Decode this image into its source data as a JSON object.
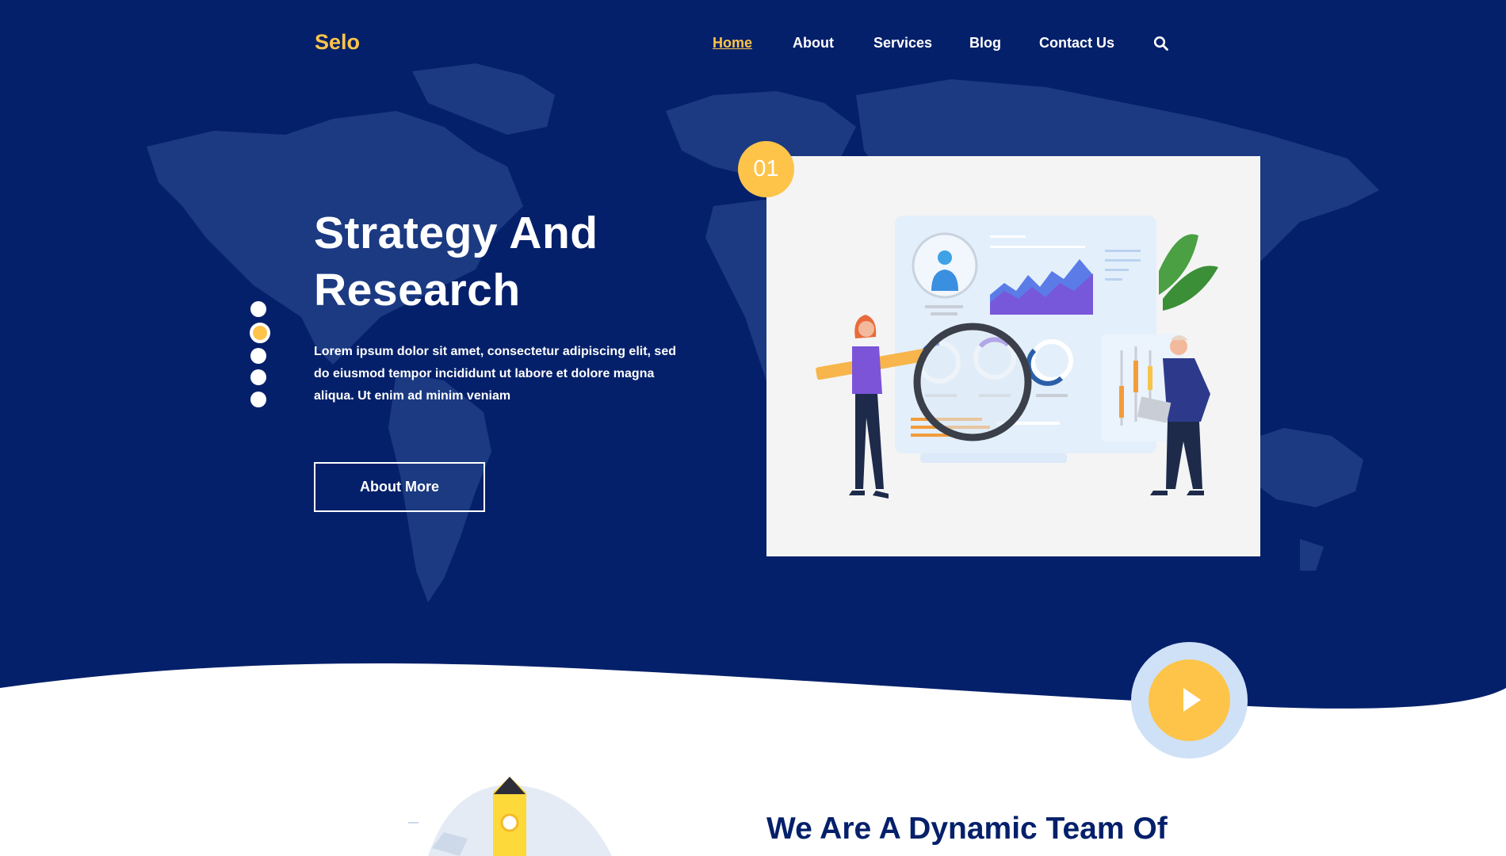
{
  "brand": {
    "logo": "Selo"
  },
  "nav": {
    "items": [
      {
        "label": "Home",
        "active": true
      },
      {
        "label": "About"
      },
      {
        "label": "Services"
      },
      {
        "label": "Blog"
      },
      {
        "label": "Contact Us"
      }
    ],
    "search_icon": "search-icon"
  },
  "hero": {
    "title_line1": "Strategy And",
    "title_line2": "Research",
    "description": "Lorem ipsum dolor sit amet, consectetur adipiscing elit, sed do eiusmod tempor incididunt ut labore et dolore magna aliqua. Ut enim ad minim veniam",
    "button_label": "About More",
    "slide_number": "01",
    "slider_dots": {
      "count": 5,
      "active_index": 1
    }
  },
  "video": {
    "icon": "play-icon"
  },
  "about_section": {
    "title": "We Are A Dynamic Team Of"
  },
  "colors": {
    "primary": "#05206a",
    "accent": "#fdc449",
    "card": "#f4f4f4",
    "play_ring": "#cfe1f7"
  }
}
